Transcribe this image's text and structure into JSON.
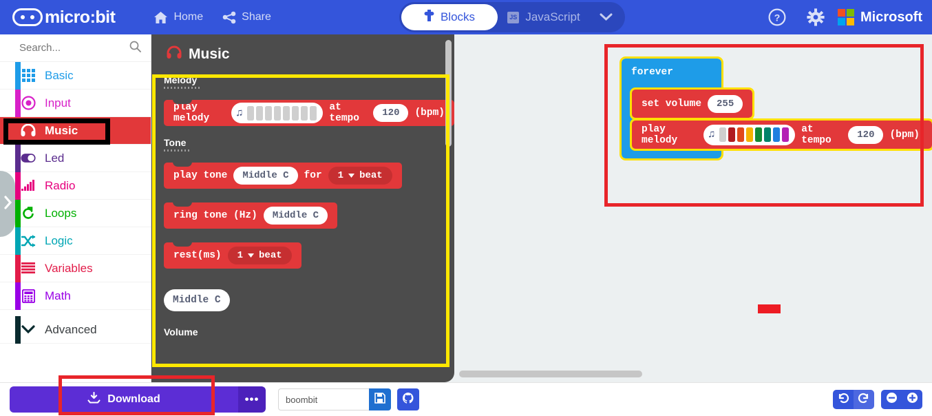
{
  "header": {
    "brand": "micro:bit",
    "logo_icon": "microbit-logo-icon",
    "home_label": "Home",
    "home_icon": "home-icon",
    "share_label": "Share",
    "share_icon": "share-icon",
    "blocks_tab": "Blocks",
    "blocks_icon": "puzzle-piece-icon",
    "javascript_tab": "JavaScript",
    "javascript_badge": "JS",
    "caret_icon": "chevron-down-icon",
    "help_icon": "help-circle-icon",
    "settings_icon": "gear-icon",
    "microsoft_label": "Microsoft",
    "microsoft_icon": "microsoft-logo-icon",
    "bg_color": "#3455db"
  },
  "sidebar": {
    "search_placeholder": "Search...",
    "search_icon": "search-icon",
    "collapse_icon": "chevron-right-icon",
    "categories": [
      {
        "label": "Basic",
        "color": "#1e9ce8",
        "icon": "grid-icon",
        "selected": false
      },
      {
        "label": "Input",
        "color": "#d820c8",
        "icon": "target-icon",
        "selected": false
      },
      {
        "label": "Music",
        "color": "#e2383a",
        "icon": "headphones-icon",
        "selected": true
      },
      {
        "label": "Led",
        "color": "#5b2d8e",
        "icon": "toggle-icon",
        "selected": false
      },
      {
        "label": "Radio",
        "color": "#e6007e",
        "icon": "signal-bars-icon",
        "selected": false
      },
      {
        "label": "Loops",
        "color": "#00b000",
        "icon": "loop-arrow-icon",
        "selected": false
      },
      {
        "label": "Logic",
        "color": "#00a6b4",
        "icon": "shuffle-icon",
        "selected": false
      },
      {
        "label": "Variables",
        "color": "#e21c49",
        "icon": "lines-icon",
        "selected": false
      },
      {
        "label": "Math",
        "color": "#9900e6",
        "icon": "calculator-icon",
        "selected": false
      }
    ],
    "advanced": {
      "label": "Advanced",
      "color": "#0a2b2f",
      "icon": "chevron-down-icon"
    }
  },
  "flyout": {
    "title": "Music",
    "title_icon": "headphones-icon",
    "sections": [
      {
        "label": "Melody"
      },
      {
        "label": "Tone"
      },
      {
        "label": "Volume"
      }
    ],
    "blocks": {
      "play_melody": {
        "text_before": "play melody",
        "note_icon": "music-note-icon",
        "text_mid": "at tempo",
        "tempo": "120",
        "text_after": "(bpm)",
        "notes": [
          "#cfcfcf",
          "#cfcfcf",
          "#cfcfcf",
          "#cfcfcf",
          "#cfcfcf",
          "#cfcfcf",
          "#cfcfcf",
          "#cfcfcf"
        ]
      },
      "play_tone": {
        "text_before": "play tone",
        "note": "Middle C",
        "text_mid": "for",
        "beats": "1",
        "beat_unit": "beat",
        "dropdown_icon": "caret-down-icon"
      },
      "ring_tone": {
        "text_before": "ring tone (Hz)",
        "note": "Middle C"
      },
      "rest": {
        "text_before": "rest(ms)",
        "beats": "1",
        "beat_unit": "beat",
        "dropdown_icon": "caret-down-icon"
      },
      "middle_c_reporter": {
        "label": "Middle C"
      }
    }
  },
  "workspace": {
    "forever": {
      "label": "forever"
    },
    "set_volume": {
      "text": "set volume",
      "value": "255"
    },
    "play_melody": {
      "text_before": "play melody",
      "note_icon": "music-note-icon",
      "text_mid": "at tempo",
      "tempo": "120",
      "text_after": "(bpm)",
      "notes": [
        "#cfcfcf",
        "#b01b20",
        "#e1481b",
        "#f6b300",
        "#138a35",
        "#00836a",
        "#1e7fe0",
        "#b421b4"
      ]
    }
  },
  "bottombar": {
    "download_label": "Download",
    "download_icon": "download-icon",
    "more_label": "•••",
    "project_name": "boombit",
    "project_placeholder": "boombit",
    "save_icon": "floppy-disk-icon",
    "github_icon": "github-icon",
    "undo_icon": "undo-arrow-icon",
    "redo_icon": "redo-arrow-icon",
    "zoom_out_icon": "minus-circle-icon",
    "zoom_in_icon": "plus-circle-icon"
  },
  "annotations": {
    "music_category_box_color": "#000000",
    "flyout_box_color": "#ffe800",
    "workspace_box_color": "#e8252a",
    "download_box_color": "#e8252a"
  }
}
